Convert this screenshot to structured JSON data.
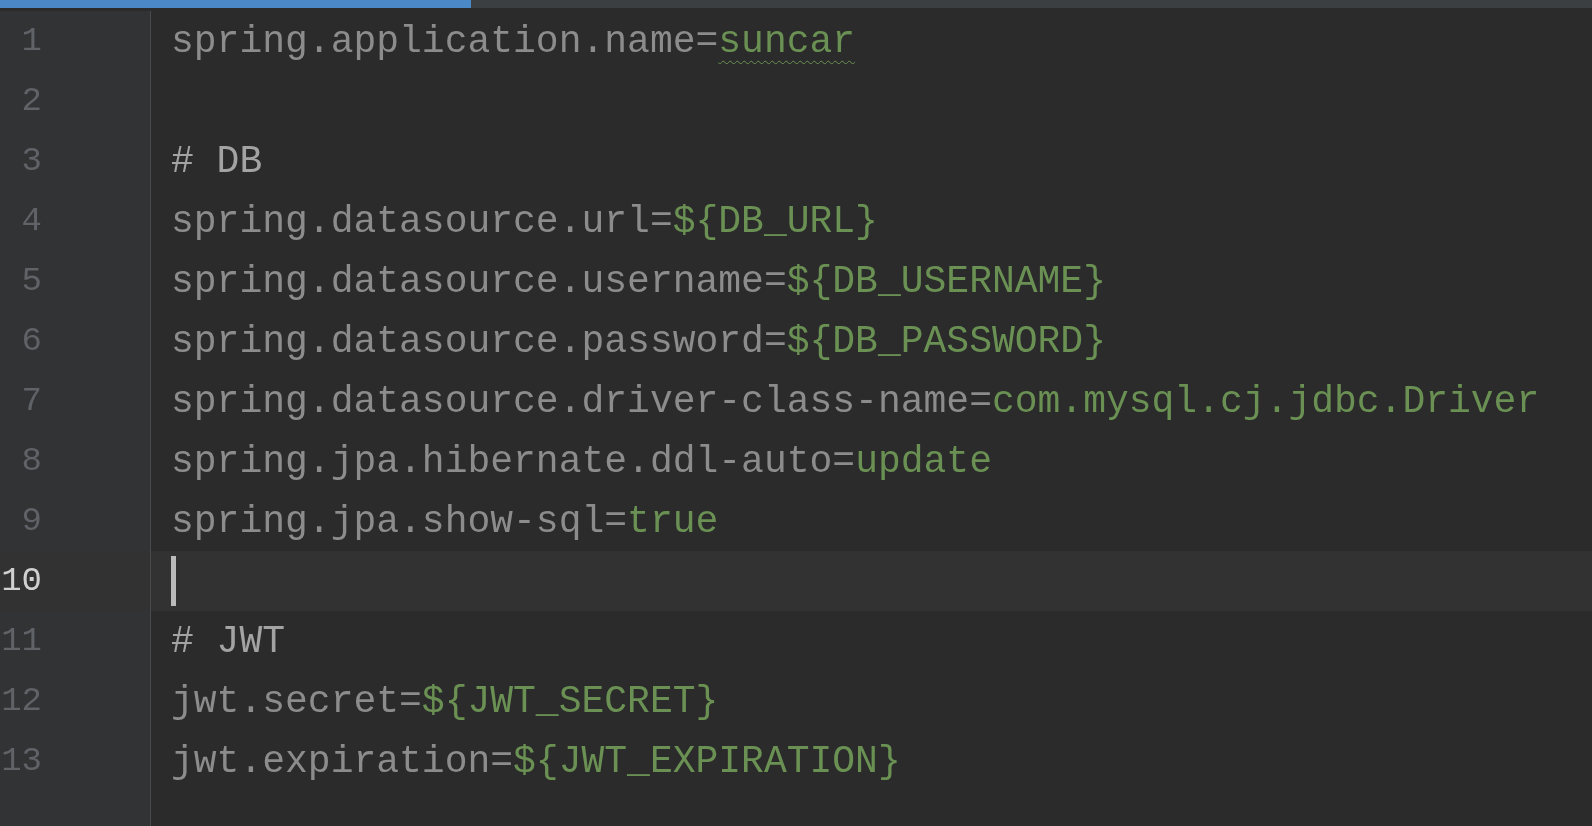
{
  "editor": {
    "lines": [
      {
        "number": "1",
        "current": false,
        "segments": [
          {
            "kind": "key",
            "text": "spring.application.name="
          },
          {
            "kind": "value",
            "text": "suncar",
            "misspelled": true
          }
        ]
      },
      {
        "number": "2",
        "current": false
      },
      {
        "number": "3",
        "current": false,
        "segments": [
          {
            "kind": "comment",
            "text": "# DB"
          }
        ]
      },
      {
        "number": "4",
        "current": false,
        "segments": [
          {
            "kind": "key",
            "text": "spring.datasource.url="
          },
          {
            "kind": "value",
            "text": "${DB_URL}"
          }
        ]
      },
      {
        "number": "5",
        "current": false,
        "segments": [
          {
            "kind": "key",
            "text": "spring.datasource.username="
          },
          {
            "kind": "value",
            "text": "${DB_USERNAME}"
          }
        ]
      },
      {
        "number": "6",
        "current": false,
        "segments": [
          {
            "kind": "key",
            "text": "spring.datasource.password="
          },
          {
            "kind": "value",
            "text": "${DB_PASSWORD}"
          }
        ]
      },
      {
        "number": "7",
        "current": false,
        "segments": [
          {
            "kind": "key",
            "text": "spring.datasource.driver-class-name="
          },
          {
            "kind": "value",
            "text": "com.mysql.cj.jdbc.Driver"
          }
        ]
      },
      {
        "number": "8",
        "current": false,
        "segments": [
          {
            "kind": "key",
            "text": "spring.jpa.hibernate.ddl-auto="
          },
          {
            "kind": "value",
            "text": "update"
          }
        ]
      },
      {
        "number": "9",
        "current": false,
        "segments": [
          {
            "kind": "key",
            "text": "spring.jpa.show-sql="
          },
          {
            "kind": "value",
            "text": "true"
          }
        ]
      },
      {
        "number": "10",
        "current": true
      },
      {
        "number": "11",
        "current": false,
        "segments": [
          {
            "kind": "comment",
            "text": "# JWT"
          }
        ]
      },
      {
        "number": "12",
        "current": false,
        "segments": [
          {
            "kind": "key",
            "text": "jwt.secret="
          },
          {
            "kind": "value",
            "text": "${JWT_SECRET}"
          }
        ]
      },
      {
        "number": "13",
        "current": false,
        "segments": [
          {
            "kind": "key",
            "text": "jwt.expiration="
          },
          {
            "kind": "value",
            "text": "${JWT_EXPIRATION}"
          }
        ]
      }
    ]
  }
}
